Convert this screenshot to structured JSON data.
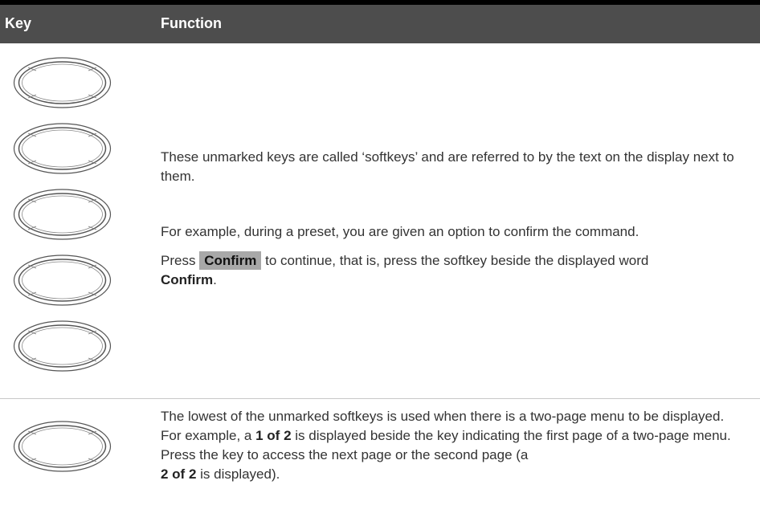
{
  "table": {
    "header": {
      "key": "Key",
      "function": "Function"
    },
    "row1": {
      "p1": "These unmarked keys are called ‘softkeys’ and are referred to by the text on the display next to them.",
      "p2": "For example, during a preset, you are given an option to confirm the command.",
      "p3_prefix": "Press",
      "p3_button": "Confirm",
      "p3_middle": "to continue, that is, press the softkey beside the displayed word",
      "p3_word": "Confirm",
      "p3_end": "."
    },
    "row2": {
      "t1": "The lowest of the unmarked softkeys is used when there is a two-page menu to be displayed. For example, a",
      "b1": "1 of 2",
      "t2": "is displayed beside the key indicating the first page of a two-page menu. Press the key to access the next page or the second page (a",
      "b2": "2 of 2",
      "t3": "is displayed)."
    }
  },
  "icons": [
    "softkey-icon"
  ]
}
